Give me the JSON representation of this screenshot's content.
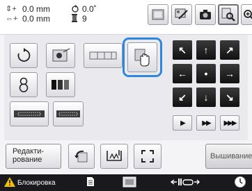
{
  "status": {
    "height_value": "0.0 mm",
    "width_value": "0.0 mm",
    "angle_value": "0.0˚",
    "color_count": "9",
    "height_icon": "height-arrows-icon",
    "width_icon": "width-arrows-icon",
    "angle_icon": "rotation-icon",
    "count_icon": "thread-spool-icon"
  },
  "toolbar": {
    "buttons": [
      "pattern-preview-icon",
      "frame-display-icon",
      "camera-icon",
      "zoom-preview-icon",
      "magnify-icon"
    ]
  },
  "panel": {
    "left_buttons": [
      "rotate-icon",
      "thread-color-icon",
      "size-icon",
      "multi-color-icon",
      "density-icon",
      "border-icon",
      "border-repeat-icon",
      "move-pattern-hand-icon"
    ]
  },
  "navigation": {
    "arrows": [
      "↖",
      "↑",
      "↗",
      "←",
      "•",
      "→",
      "↙",
      "↓",
      "↘"
    ],
    "play_labels": [
      "▶",
      "▶▶",
      "▶▶▶"
    ]
  },
  "bottom": {
    "edit_label_line1": "Редакти-",
    "edit_label_line2": "рование",
    "embroider_label": "Вышивание"
  },
  "footer": {
    "lock_label": "Блокировка",
    "lock_icon": "warning-icon",
    "page_icon": "page-icon",
    "photo_icon": "frame-icon",
    "presser_icon": "presser-foot-icon",
    "clock_icon": "clock-icon"
  },
  "colors": {
    "highlight": "#2f86e0",
    "footer_bg": "#1a1a1e",
    "arrow_bg": "#111111",
    "warning": "#f2c200"
  }
}
